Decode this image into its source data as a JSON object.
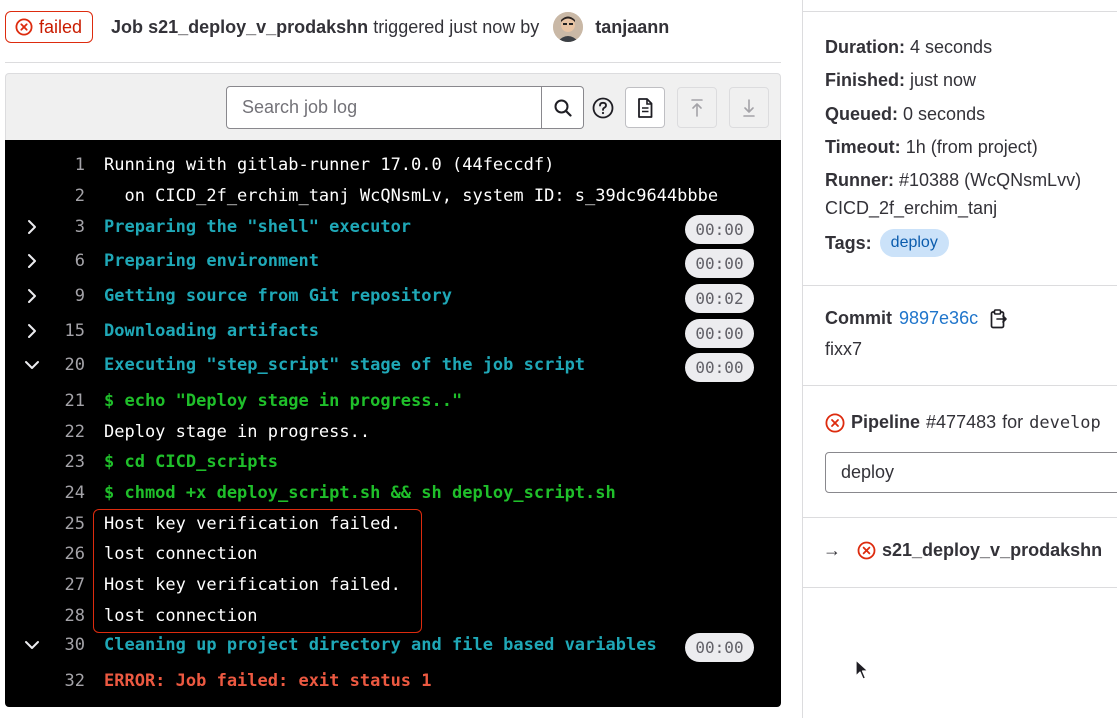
{
  "header": {
    "status_label": "failed",
    "job_prefix": "Job",
    "job_name": "s21_deploy_v_prodakshn",
    "triggered_text": "triggered just now by",
    "username": "tanjaann"
  },
  "toolbar": {
    "search_placeholder": "Search job log"
  },
  "log": {
    "lines": [
      {
        "no": "1",
        "text": "Running with gitlab-runner 17.0.0 (44feccdf)",
        "style": "white"
      },
      {
        "no": "2",
        "text": "  on CICD_2f_erchim_tanj WcQNsmLv, system ID: s_39dc9644bbbe",
        "style": "white"
      },
      {
        "no": "3",
        "text": "Preparing the \"shell\" executor",
        "style": "cyan",
        "caret": "right",
        "duration": "00:00"
      },
      {
        "no": "6",
        "text": "Preparing environment",
        "style": "cyan",
        "caret": "right",
        "duration": "00:00"
      },
      {
        "no": "9",
        "text": "Getting source from Git repository",
        "style": "cyan",
        "caret": "right",
        "duration": "00:02"
      },
      {
        "no": "15",
        "text": "Downloading artifacts",
        "style": "cyan",
        "caret": "right",
        "duration": "00:00"
      },
      {
        "no": "20",
        "text": "Executing \"step_script\" stage of the job script",
        "style": "cyan",
        "caret": "down",
        "duration": "00:00"
      },
      {
        "no": "21",
        "text": "$ echo \"Deploy stage in progress..\"",
        "style": "green"
      },
      {
        "no": "22",
        "text": "Deploy stage in progress..",
        "style": "white"
      },
      {
        "no": "23",
        "text": "$ cd CICD_scripts",
        "style": "green"
      },
      {
        "no": "24",
        "text": "$ chmod +x deploy_script.sh && sh deploy_script.sh",
        "style": "green"
      },
      {
        "no": "25",
        "text": "Host key verification failed.",
        "style": "white"
      },
      {
        "no": "26",
        "text": "lost connection",
        "style": "white"
      },
      {
        "no": "27",
        "text": "Host key verification failed.",
        "style": "white"
      },
      {
        "no": "28",
        "text": "lost connection",
        "style": "white"
      },
      {
        "no": "30",
        "text": "Cleaning up project directory and file based variables",
        "style": "cyan",
        "caret": "down",
        "duration": "00:00"
      },
      {
        "no": "32",
        "text": "ERROR: Job failed: exit status 1",
        "style": "red"
      }
    ]
  },
  "sidebar": {
    "duration_label": "Duration:",
    "duration_value": "4 seconds",
    "finished_label": "Finished:",
    "finished_value": "just now",
    "queued_label": "Queued:",
    "queued_value": "0 seconds",
    "timeout_label": "Timeout:",
    "timeout_value": "1h (from project)",
    "runner_label": "Runner:",
    "runner_value": "#10388 (WcQNsmLvv)",
    "runner_name": "CICD_2f_erchim_tanj",
    "tags_label": "Tags:",
    "tag": "deploy",
    "commit_label": "Commit",
    "commit_sha": "9897e36c",
    "commit_message": "fixx7",
    "pipeline_label": "Pipeline",
    "pipeline_id": "#477483",
    "pipeline_for": "for",
    "pipeline_branch": "develop",
    "stage_value": "deploy",
    "job_arrow": "→",
    "job_name": "s21_deploy_v_prodakshn"
  },
  "colors": {
    "failed_red": "#dd2b0e",
    "log_bg": "#000000",
    "section_cyan": "#1fa8b7",
    "command_green": "#1fbf2a",
    "error_red": "#ec5941",
    "link_blue": "#1f75cb"
  },
  "icons": {
    "status": "status-failed-icon",
    "search": "search-icon",
    "help": "question-circle-icon",
    "raw": "document-icon",
    "scroll_top": "scroll-up-icon",
    "scroll_bottom": "scroll-down-icon",
    "copy": "copy-to-clipboard-icon"
  }
}
